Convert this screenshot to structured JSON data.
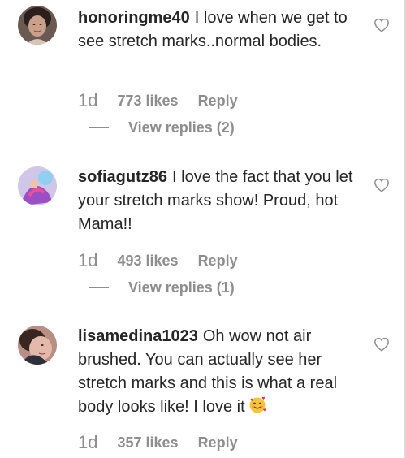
{
  "comments": [
    {
      "username": "honoringme40",
      "text": "I love when we get to see stretch marks..normal bodies.",
      "time": "1d",
      "likes": "773 likes",
      "reply_label": "Reply",
      "replies_label": "View replies (2)",
      "avatar_icon": "profile-photo-woman"
    },
    {
      "username": "sofiagutz86",
      "text": "I love the fact that you let your stretch marks show! Proud, hot Mama!!",
      "time": "1d",
      "likes": "493 likes",
      "reply_label": "Reply",
      "replies_label": "View replies (1)",
      "avatar_icon": "profile-photo-illustration"
    },
    {
      "username": "lisamedina1023",
      "text": "Oh wow not air brushed. You can actually see her stretch marks and this is what a real body looks like! I love it",
      "emoji": "smiling-face-with-hearts",
      "time": "1d",
      "likes": "357 likes",
      "reply_label": "Reply",
      "avatar_icon": "profile-photo-woman"
    }
  ],
  "colors": {
    "text": "#262626",
    "muted": "#8e8e8e"
  },
  "icons": {
    "like": "heart-outline-icon"
  }
}
